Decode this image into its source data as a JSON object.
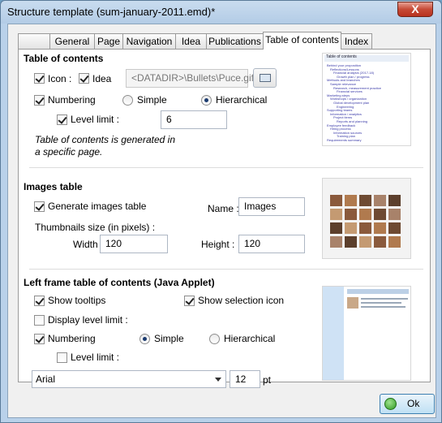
{
  "window": {
    "title": "Structure template (sum-january-2011.emd)*",
    "close_label": "X"
  },
  "tabs": [
    {
      "label": ""
    },
    {
      "label": "General"
    },
    {
      "label": "Page"
    },
    {
      "label": "Navigation"
    },
    {
      "label": "Idea"
    },
    {
      "label": "Publications"
    },
    {
      "label": "Table of contents"
    },
    {
      "label": "Index"
    }
  ],
  "toc": {
    "title": "Table of contents",
    "icon_label": "Icon :",
    "idea_label": "Idea",
    "icon_path": "<DATADIR>\\Bullets\\Puce.gif",
    "numbering_label": "Numbering",
    "simple_label": "Simple",
    "hierarchical_label": "Hierarchical",
    "level_limit_label": "Level limit :",
    "level_limit_value": "6",
    "note": "Table of contents is generated in a specific page.",
    "preview_heading": "Table of contents",
    "preview_lines": [
      "Behind your proposition",
      "Reflections/Lessons",
      "Financial analysis (2017-18)",
      "Growth plan / progress",
      "Methods and branches",
      "Sample relevance",
      "Research, measurement practice",
      "Financial services",
      "Marketing steps",
      "Workshops / organization",
      "Global development plan",
      "Engineering",
      "Supporting teams",
      "Information / analytics",
      "Project items",
      "Reports and planning",
      "Employee feedback",
      "Hiring process",
      "Information sources",
      "Training plan",
      "Requirements summary"
    ]
  },
  "images": {
    "title": "Images table",
    "generate_label": "Generate images table",
    "name_label": "Name :",
    "name_value": "Images",
    "thumb_label": "Thumbnails size (in pixels) :",
    "width_label": "Width :",
    "width_value": "120",
    "height_label": "Height :",
    "height_value": "120"
  },
  "leftframe": {
    "title": "Left frame table of contents (Java Applet)",
    "tooltips_label": "Show tooltips",
    "selection_icon_label": "Show selection icon",
    "display_level_label": "Display level limit :",
    "numbering_label": "Numbering",
    "simple_label": "Simple",
    "hierarchical_label": "Hierarchical",
    "level_limit_label": "Level limit :",
    "font_value": "Arial",
    "size_value": "12",
    "pt_label": "pt"
  },
  "ok_label": "Ok",
  "colors": {
    "accent": "#3c7fb1",
    "title_bar": "#b9d1ea",
    "close": "#c64a36"
  }
}
